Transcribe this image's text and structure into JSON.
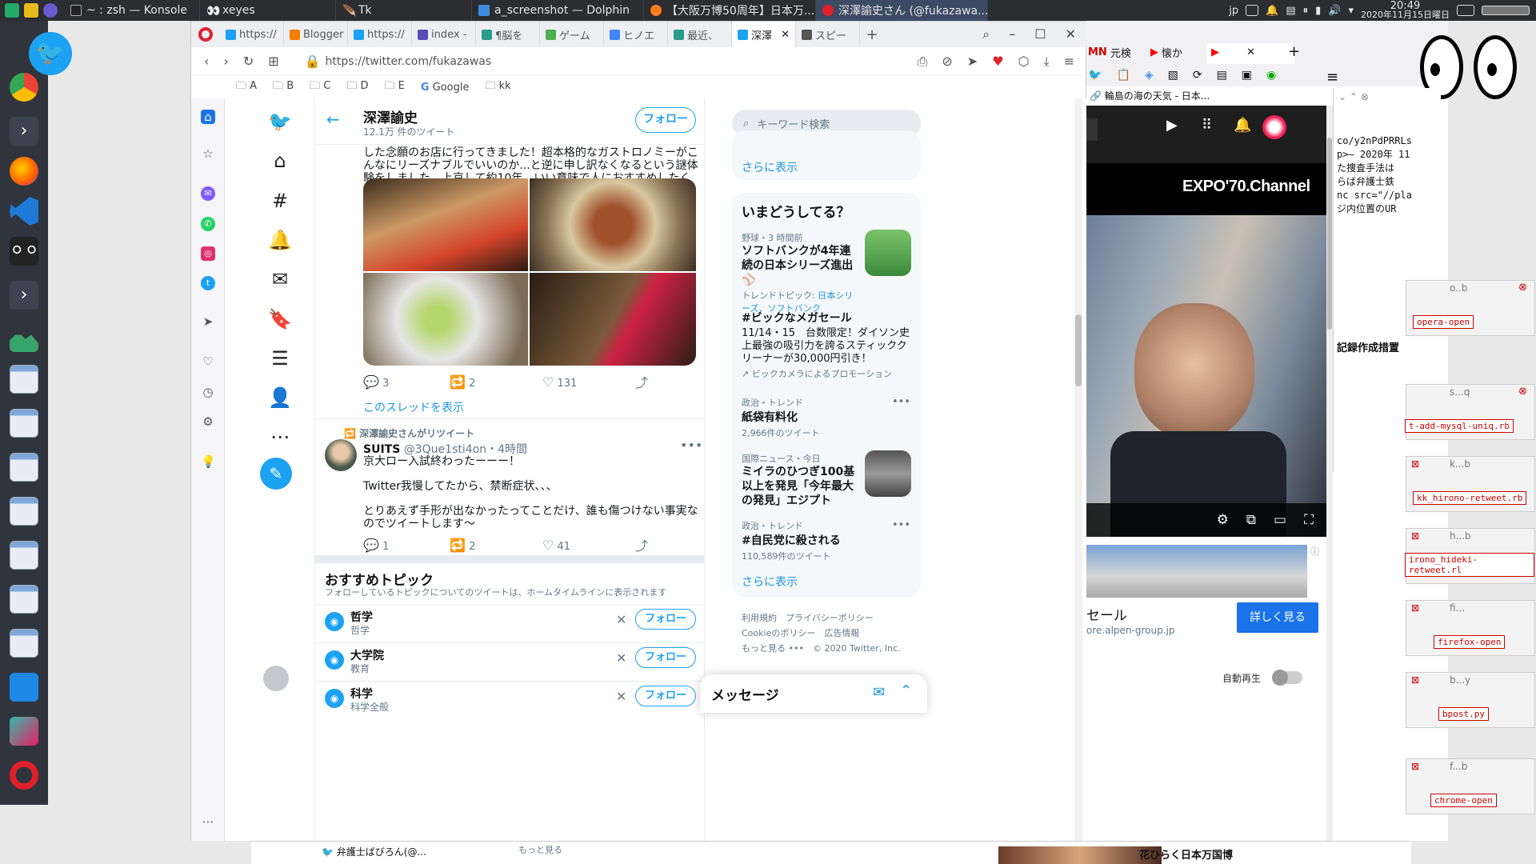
{
  "taskbar": {
    "tasks": [
      {
        "label": "~ : zsh — Konsole",
        "icon": "terminal-icon"
      },
      {
        "label": "xeyes",
        "icon": "eyes-icon"
      },
      {
        "label": "Tk",
        "icon": "feather-icon"
      },
      {
        "label": "a_screenshot — Dolphin",
        "icon": "folder-icon"
      },
      {
        "label": "【大阪万博50周年】日本万...",
        "icon": "firefox-icon"
      },
      {
        "label": "深澤諭史さん (@fukazawa...",
        "icon": "opera-icon"
      }
    ],
    "ime": "jp",
    "time": "20:49",
    "date": "2020年11月15日曜日"
  },
  "browser": {
    "tabs": [
      "https://",
      "Blogger",
      "https://",
      "index -",
      "¶脳を",
      "ゲーム",
      "ヒノエ",
      "最近、",
      "深澤",
      "スピー"
    ],
    "url": "https://twitter.com/fukazawas",
    "bookmarks": [
      "A",
      "B",
      "C",
      "D",
      "E",
      "Google",
      "kk"
    ]
  },
  "twitter": {
    "profile_name": "深澤諭史",
    "tweet_count": "12.1万 件のツイート",
    "follow_label": "フォロー",
    "tweet1_text": "した念願のお店に行ってきました！超本格的なガストロノミーがこんなにリーズナブルでいいのか...と逆に申し訳なくなるという謎体験をしました。上京して約10年。いい意味で人におすすめしたくないお店は初めてです",
    "tweet1_replies": "3",
    "tweet1_retweets": "2",
    "tweet1_likes": "131",
    "show_thread": "このスレッドを表示",
    "retweet_note": "深澤諭史さんがリツイート",
    "tweet2_name": "SUITS",
    "tweet2_handle": "@3Que1sti4on",
    "tweet2_time": "・4時間",
    "tweet2_line1": "京大ロー入試終わったーーー！",
    "tweet2_line2": "Twitter我慢してたから、禁断症状、、、",
    "tweet2_line3": "とりあえず手形が出なかったってことだけ、誰も傷つけない事実なのでツイートします〜",
    "tweet2_replies": "1",
    "tweet2_retweets": "2",
    "tweet2_likes": "41",
    "topics_title": "おすすめトピック",
    "topics_sub": "フォローしているトピックについてのツイートは、ホームタイムラインに表示されます",
    "topics": [
      {
        "name": "哲学",
        "cat": "哲学"
      },
      {
        "name": "大学院",
        "cat": "教育"
      },
      {
        "name": "科学",
        "cat": "科学全般"
      }
    ],
    "search_placeholder": "キーワード検索",
    "show_more": "さらに表示",
    "trends_title": "いまどうしてる？",
    "trend1_cat": "野球・3 時間前",
    "trend1_title": "ソフトバンクが4年連続の日本シリーズ進出⚾",
    "trend1_topic_label": "トレンドトピック: ",
    "trend1_topic": "日本シリーズ、ソフトバンク",
    "trend2_title": "#ビックなメガセール",
    "trend2_desc": "11/14・15　台数限定！ダイソン史上最強の吸引力を誇るスティッククリーナーが30,000円引き！",
    "trend2_promo": "ビックカメラによるプロモーション",
    "trend3_cat": "政治・トレンド",
    "trend3_title": "紙袋有料化",
    "trend3_count": "2,966件のツイート",
    "trend4_cat": "国際ニュース・今日",
    "trend4_title": "ミイラのひつぎ100基以上を発見「今年最大の発見」エジプト",
    "trend5_cat": "政治・トレンド",
    "trend5_title": "#自民党に殺される",
    "trend5_count": "110,589件のツイート",
    "footer1": "利用規約　プライバシーポリシー",
    "footer2": "Cookieのポリシー　広告情報",
    "footer3": "もっと見る •••　© 2020 Twitter, Inc.",
    "messages": "メッセージ",
    "below1": "弁護士ばびろん(@...",
    "below2": "もっと見る"
  },
  "vivaldi": {
    "tab1": "元検",
    "tab2": "懐か",
    "weather": "輪島の海の天気 - 日本...",
    "video_title": "EXPO'70.Channel",
    "ad_title": "セール",
    "ad_domain": "ore.alpen-group.jp",
    "ad_button": "詳しく見る",
    "autoplay": "自動再生",
    "related": "花ひらく日本万国博",
    "code": "co/y2nPdPRRLs\np>— 2020年 11\nた捜査手法は\nらば弁護士鉄\nnc src=\"//pla\nジ内位置のUR",
    "code2": "記録作成措置"
  },
  "notes": [
    {
      "head": "o..b",
      "label": "opera-open"
    },
    {
      "head": "s...q",
      "label": "t-add-mysql-uniq.rb"
    },
    {
      "head": "k...b",
      "label": "kk_hirono-retweet.rb"
    },
    {
      "head": "h...b",
      "label": "irono_hideki-retweet.rl"
    },
    {
      "head": "fi...",
      "label": "firefox-open"
    },
    {
      "head": "b...y",
      "label": "bpost.py"
    },
    {
      "head": "f...b",
      "label": "chrome-open"
    }
  ],
  "colors": {
    "twitter_blue": "#1da1f2",
    "opera_red": "#e0202b",
    "taskbar": "#2b2d31"
  }
}
